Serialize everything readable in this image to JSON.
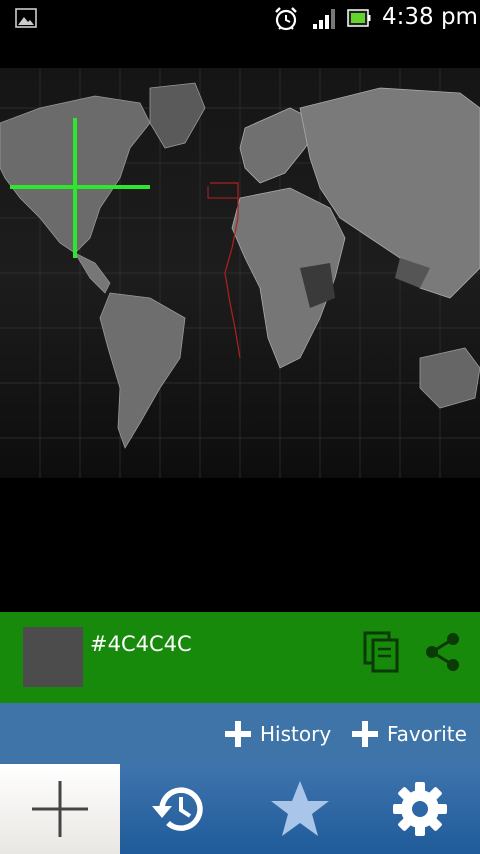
{
  "status_bar": {
    "time": "4:38 pm",
    "icons": [
      "gallery-icon",
      "alarm-icon",
      "signal-icon",
      "battery-icon"
    ]
  },
  "picked_color": {
    "hex": "#4C4C4C",
    "swatch_color": "#4C4C4C",
    "bar_color": "#178A0B"
  },
  "actions": {
    "history_label": "History",
    "favorite_label": "Favorite"
  },
  "tabs": [
    {
      "icon": "plus-icon",
      "selected": true
    },
    {
      "icon": "history-icon",
      "selected": false
    },
    {
      "icon": "star-icon",
      "selected": false
    },
    {
      "icon": "gear-icon",
      "selected": false
    }
  ]
}
